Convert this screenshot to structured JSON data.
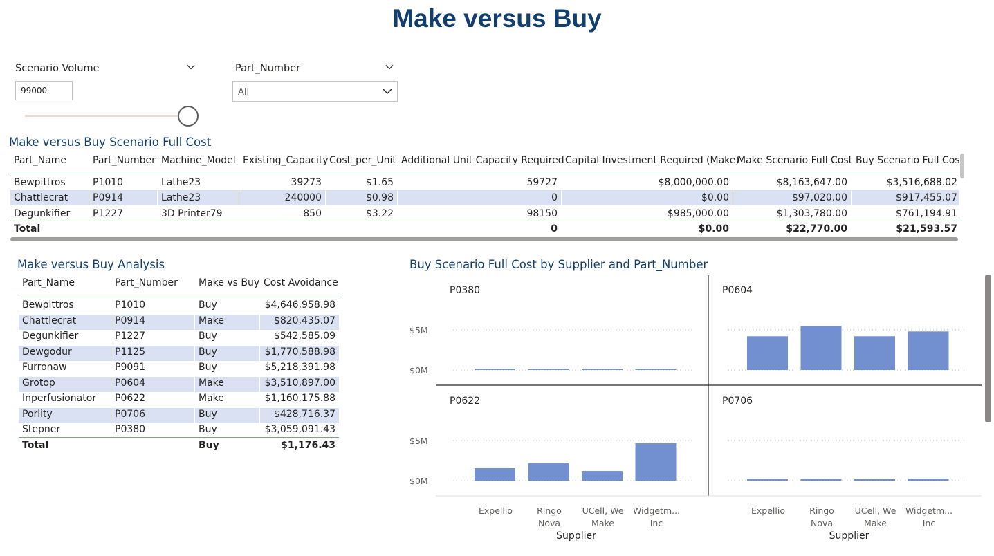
{
  "page_title": "Make versus Buy",
  "slicers": {
    "volume": {
      "title": "Scenario Volume",
      "value": "99000"
    },
    "part": {
      "title": "Part_Number",
      "selected": "All"
    }
  },
  "table1": {
    "title": "Make versus Buy Scenario Full Cost",
    "headers": [
      "Part_Name",
      "Part_Number",
      "Machine_Model",
      "Existing_Capacity",
      "Cost_per_Unit",
      "Additional Unit Capacity Required",
      "Capital Investment Required (Make)",
      "Make Scenario Full Cost",
      "Buy Scenario Full Cost"
    ],
    "rows": [
      [
        "Bewpittros",
        "P1010",
        "Lathe23",
        "39273",
        "$1.65",
        "59727",
        "$8,000,000.00",
        "$8,163,647.00",
        "$3,516,688.02"
      ],
      [
        "Chattlecrat",
        "P0914",
        "Lathe23",
        "240000",
        "$0.98",
        "0",
        "$0.00",
        "$97,020.00",
        "$917,455.07"
      ],
      [
        "Degunkifier",
        "P1227",
        "3D Printer79",
        "850",
        "$3.22",
        "98150",
        "$985,000.00",
        "$1,303,780.00",
        "$761,194.91"
      ]
    ],
    "total": [
      "Total",
      "",
      "",
      "",
      "",
      "0",
      "$0.00",
      "$22,770.00",
      "$21,593.57"
    ]
  },
  "table2": {
    "title": "Make versus Buy Analysis",
    "headers": [
      "Part_Name",
      "Part_Number",
      "Make vs Buy",
      "Cost Avoidance"
    ],
    "rows": [
      [
        "Bewpittros",
        "P1010",
        "Buy",
        "$4,646,958.98"
      ],
      [
        "Chattlecrat",
        "P0914",
        "Make",
        "$820,435.07"
      ],
      [
        "Degunkifier",
        "P1227",
        "Buy",
        "$542,585.09"
      ],
      [
        "Dewgodur",
        "P1125",
        "Buy",
        "$1,770,588.98"
      ],
      [
        "Furronaw",
        "P9091",
        "Buy",
        "$5,218,391.98"
      ],
      [
        "Grotop",
        "P0604",
        "Make",
        "$3,510,897.00"
      ],
      [
        "Inperfusionator",
        "P0622",
        "Make",
        "$1,160,175.88"
      ],
      [
        "Porlity",
        "P0706",
        "Buy",
        "$428,716.37"
      ],
      [
        "Stepner",
        "P0380",
        "Buy",
        "$3,059,091.43"
      ]
    ],
    "total": [
      "Total",
      "",
      "Buy",
      "$1,176.43"
    ]
  },
  "chart_data": {
    "type": "bar",
    "title": "Buy Scenario Full Cost by Supplier and Part_Number",
    "xlabel": "Supplier",
    "ylabel": "",
    "categories": [
      "Expellio",
      "Ringo Nova",
      "UCell, We Make",
      "Widgetm... Inc"
    ],
    "category_lines": [
      [
        "Expellio"
      ],
      [
        "Ringo",
        "Nova"
      ],
      [
        "UCell, We",
        "Make"
      ],
      [
        "Widgetm...",
        "Inc"
      ]
    ],
    "yticks": [
      "$5M",
      "$0M"
    ],
    "ylim": [
      0,
      7000000
    ],
    "bar_color": "#7290d0",
    "panels": [
      {
        "name": "P0380",
        "values": [
          110000,
          110000,
          110000,
          110000
        ]
      },
      {
        "name": "P0604",
        "values": [
          4200000,
          5500000,
          4200000,
          4800000
        ]
      },
      {
        "name": "P0622",
        "values": [
          1550000,
          2150000,
          1200000,
          4650000
        ]
      },
      {
        "name": "P0706",
        "values": [
          190000,
          200000,
          180000,
          240000
        ]
      }
    ]
  }
}
